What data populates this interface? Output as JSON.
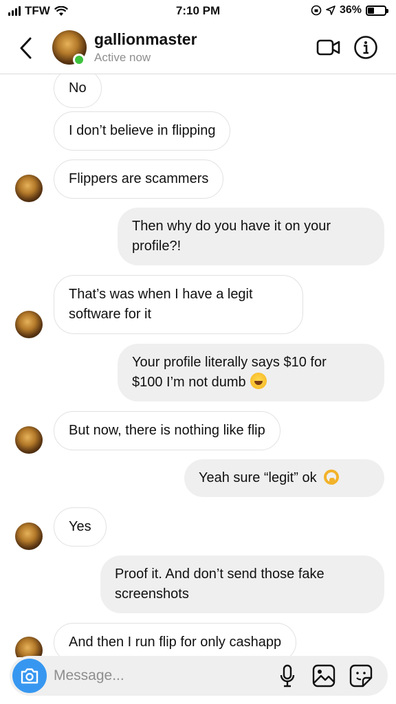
{
  "status_bar": {
    "carrier": "TFW",
    "time": "7:10 PM",
    "battery": "36%",
    "battery_level": 0.36
  },
  "header": {
    "username": "gallionmaster",
    "status": "Active now"
  },
  "messages": [
    {
      "side": "in",
      "text": "No"
    },
    {
      "side": "in",
      "text": "I don’t believe in flipping"
    },
    {
      "side": "in",
      "text": "Flippers are scammers"
    },
    {
      "side": "out",
      "line1": "Then why do you have it on your",
      "line2": "profile?!"
    },
    {
      "side": "in",
      "line1": "That’s was when I have a legit",
      "line2": "software for it"
    },
    {
      "side": "out",
      "line1": "Your profile literally says $10 for",
      "line2": "$100 I’m not dumb",
      "emoji": "face-with-tears-of-joy"
    },
    {
      "side": "in",
      "text": "But now, there is nothing like flip"
    },
    {
      "side": "out",
      "text": "Yeah sure “legit” ok",
      "emoji": "ok-hand"
    },
    {
      "side": "in",
      "text": "Yes"
    },
    {
      "side": "out",
      "line1": "Proof it. And don’t send those fake",
      "line2": "screenshots"
    },
    {
      "side": "in",
      "text": "And then I run flip for only cashapp"
    }
  ],
  "composer": {
    "placeholder": "Message..."
  },
  "icons": [
    "back-chevron-icon",
    "video-camera-icon",
    "info-icon",
    "camera-icon",
    "microphone-icon",
    "gallery-icon",
    "sticker-icon"
  ],
  "colors": {
    "accent": "#3797f0",
    "online": "#3ec23e",
    "outgoing_bubble": "#efefef",
    "incoming_border": "#e1e1e1",
    "secondary_text": "#8e8e8e"
  }
}
